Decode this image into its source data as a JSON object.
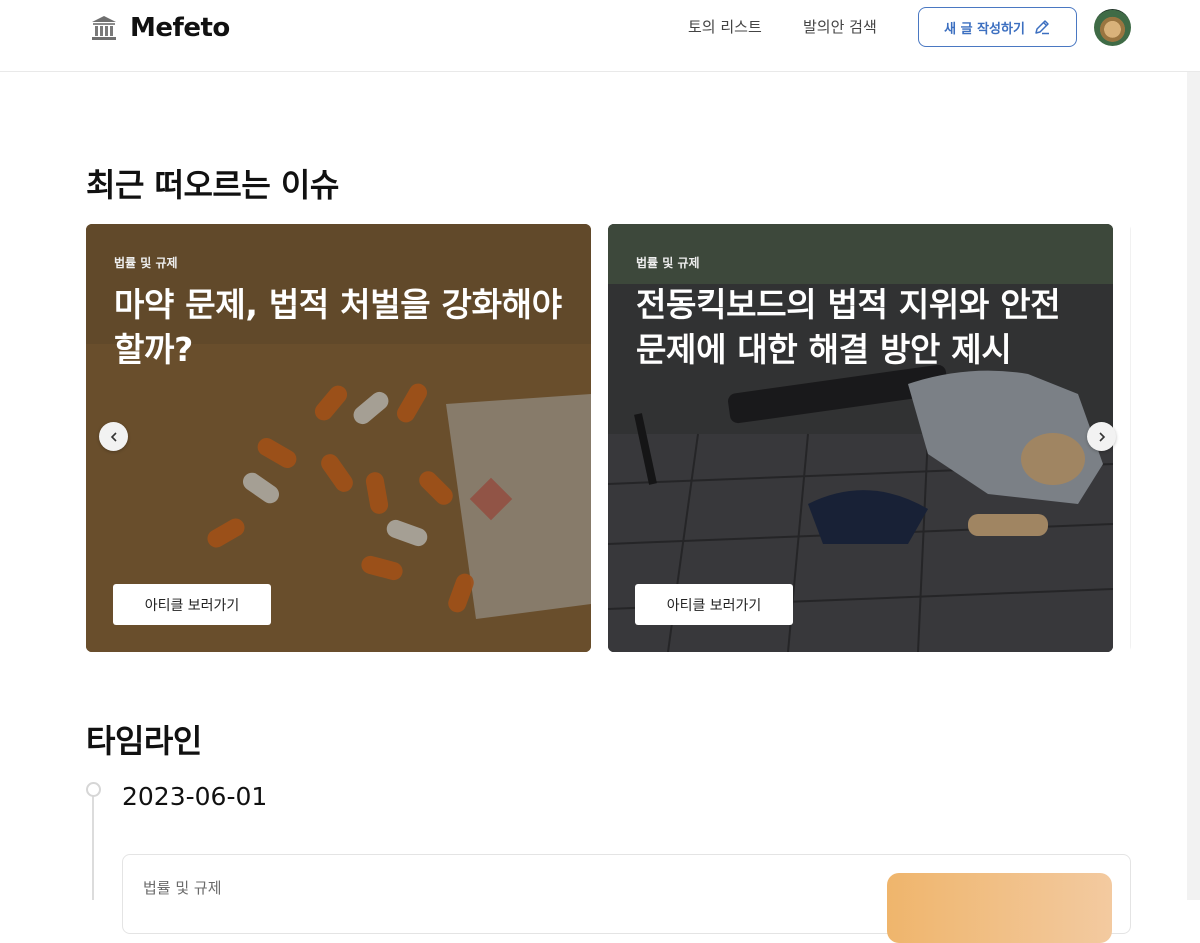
{
  "header": {
    "logo_text": "Mefeto",
    "logo_icon": "bank-icon",
    "nav": {
      "discussions": "토의 리스트",
      "search": "발의안 검색"
    },
    "write_button": "새 글 작성하기",
    "write_icon": "pencil-icon",
    "accent_color": "#3c6fc0"
  },
  "issues": {
    "title": "최근 떠오르는 이슈",
    "cards": [
      {
        "category": "법률 및 규제",
        "title": "마약 문제, 법적 처벌을 강화해야 할까?",
        "button": "아티클 보러가기"
      },
      {
        "category": "법률 및 규제",
        "title": "전동킥보드의 법적 지위와 안전 문제에 대한 해결 방안 제시",
        "button": "아티클 보러가기"
      }
    ]
  },
  "timeline": {
    "title": "타임라인",
    "entries": [
      {
        "date": "2023-06-01",
        "category": "법률 및 규제"
      }
    ]
  }
}
